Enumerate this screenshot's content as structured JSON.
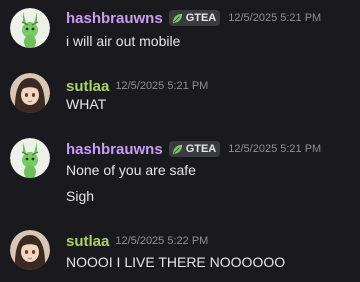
{
  "messages": [
    {
      "username": "hashbrauwns",
      "username_color": "#c89df2",
      "tag": {
        "icon": "leaf-icon",
        "label": "GTEA",
        "icon_color": "#7ec86a"
      },
      "timestamp": "12/5/2025 5:21 PM",
      "avatar": "green-rabbit-avatar",
      "lines": [
        "i will air out mobile"
      ]
    },
    {
      "username": "sutlaa",
      "username_color": "#a9d36a",
      "timestamp": "12/5/2025 5:21 PM",
      "avatar": "dark-hair-girl-avatar",
      "lines": [
        "WHAT"
      ]
    },
    {
      "username": "hashbrauwns",
      "username_color": "#c89df2",
      "tag": {
        "icon": "leaf-icon",
        "label": "GTEA",
        "icon_color": "#7ec86a"
      },
      "timestamp": "12/5/2025 5:21 PM",
      "avatar": "green-rabbit-avatar",
      "lines": [
        "None of you are safe",
        "Sigh"
      ]
    },
    {
      "username": "sutlaa",
      "username_color": "#a9d36a",
      "timestamp": "12/5/2025 5:22 PM",
      "avatar": "dark-hair-girl-avatar",
      "lines": [
        "NOOOI I LIVE THERE NOOOOOO"
      ]
    }
  ]
}
